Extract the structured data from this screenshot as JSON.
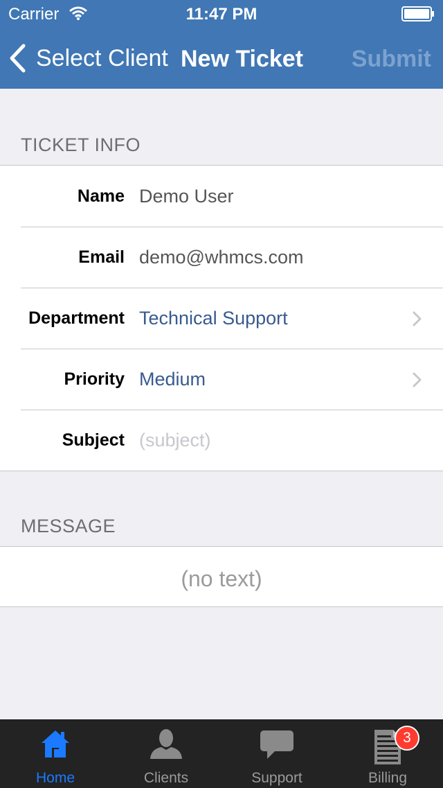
{
  "status_bar": {
    "carrier": "Carrier",
    "time": "11:47 PM"
  },
  "nav": {
    "back_label": "Select Client",
    "title": "New Ticket",
    "submit_label": "Submit"
  },
  "ticket_info": {
    "header": "TICKET INFO",
    "rows": [
      {
        "label": "Name",
        "value": "Demo User"
      },
      {
        "label": "Email",
        "value": "demo@whmcs.com"
      },
      {
        "label": "Department",
        "value": "Technical Support"
      },
      {
        "label": "Priority",
        "value": "Medium"
      },
      {
        "label": "Subject",
        "value": "",
        "placeholder": "(subject)"
      }
    ]
  },
  "message": {
    "header": "MESSAGE",
    "placeholder": "(no text)"
  },
  "tabbar": {
    "tabs": [
      {
        "label": "Home",
        "icon": "house-icon",
        "active": true
      },
      {
        "label": "Clients",
        "icon": "person-icon"
      },
      {
        "label": "Support",
        "icon": "speech-bubble-icon"
      },
      {
        "label": "Billing",
        "icon": "document-icon",
        "badge": "3"
      }
    ]
  },
  "colors": {
    "nav_bar": "#4077b4",
    "tint": "#1b7aff",
    "badge": "#ff3b30",
    "link_value": "#385a8f"
  }
}
